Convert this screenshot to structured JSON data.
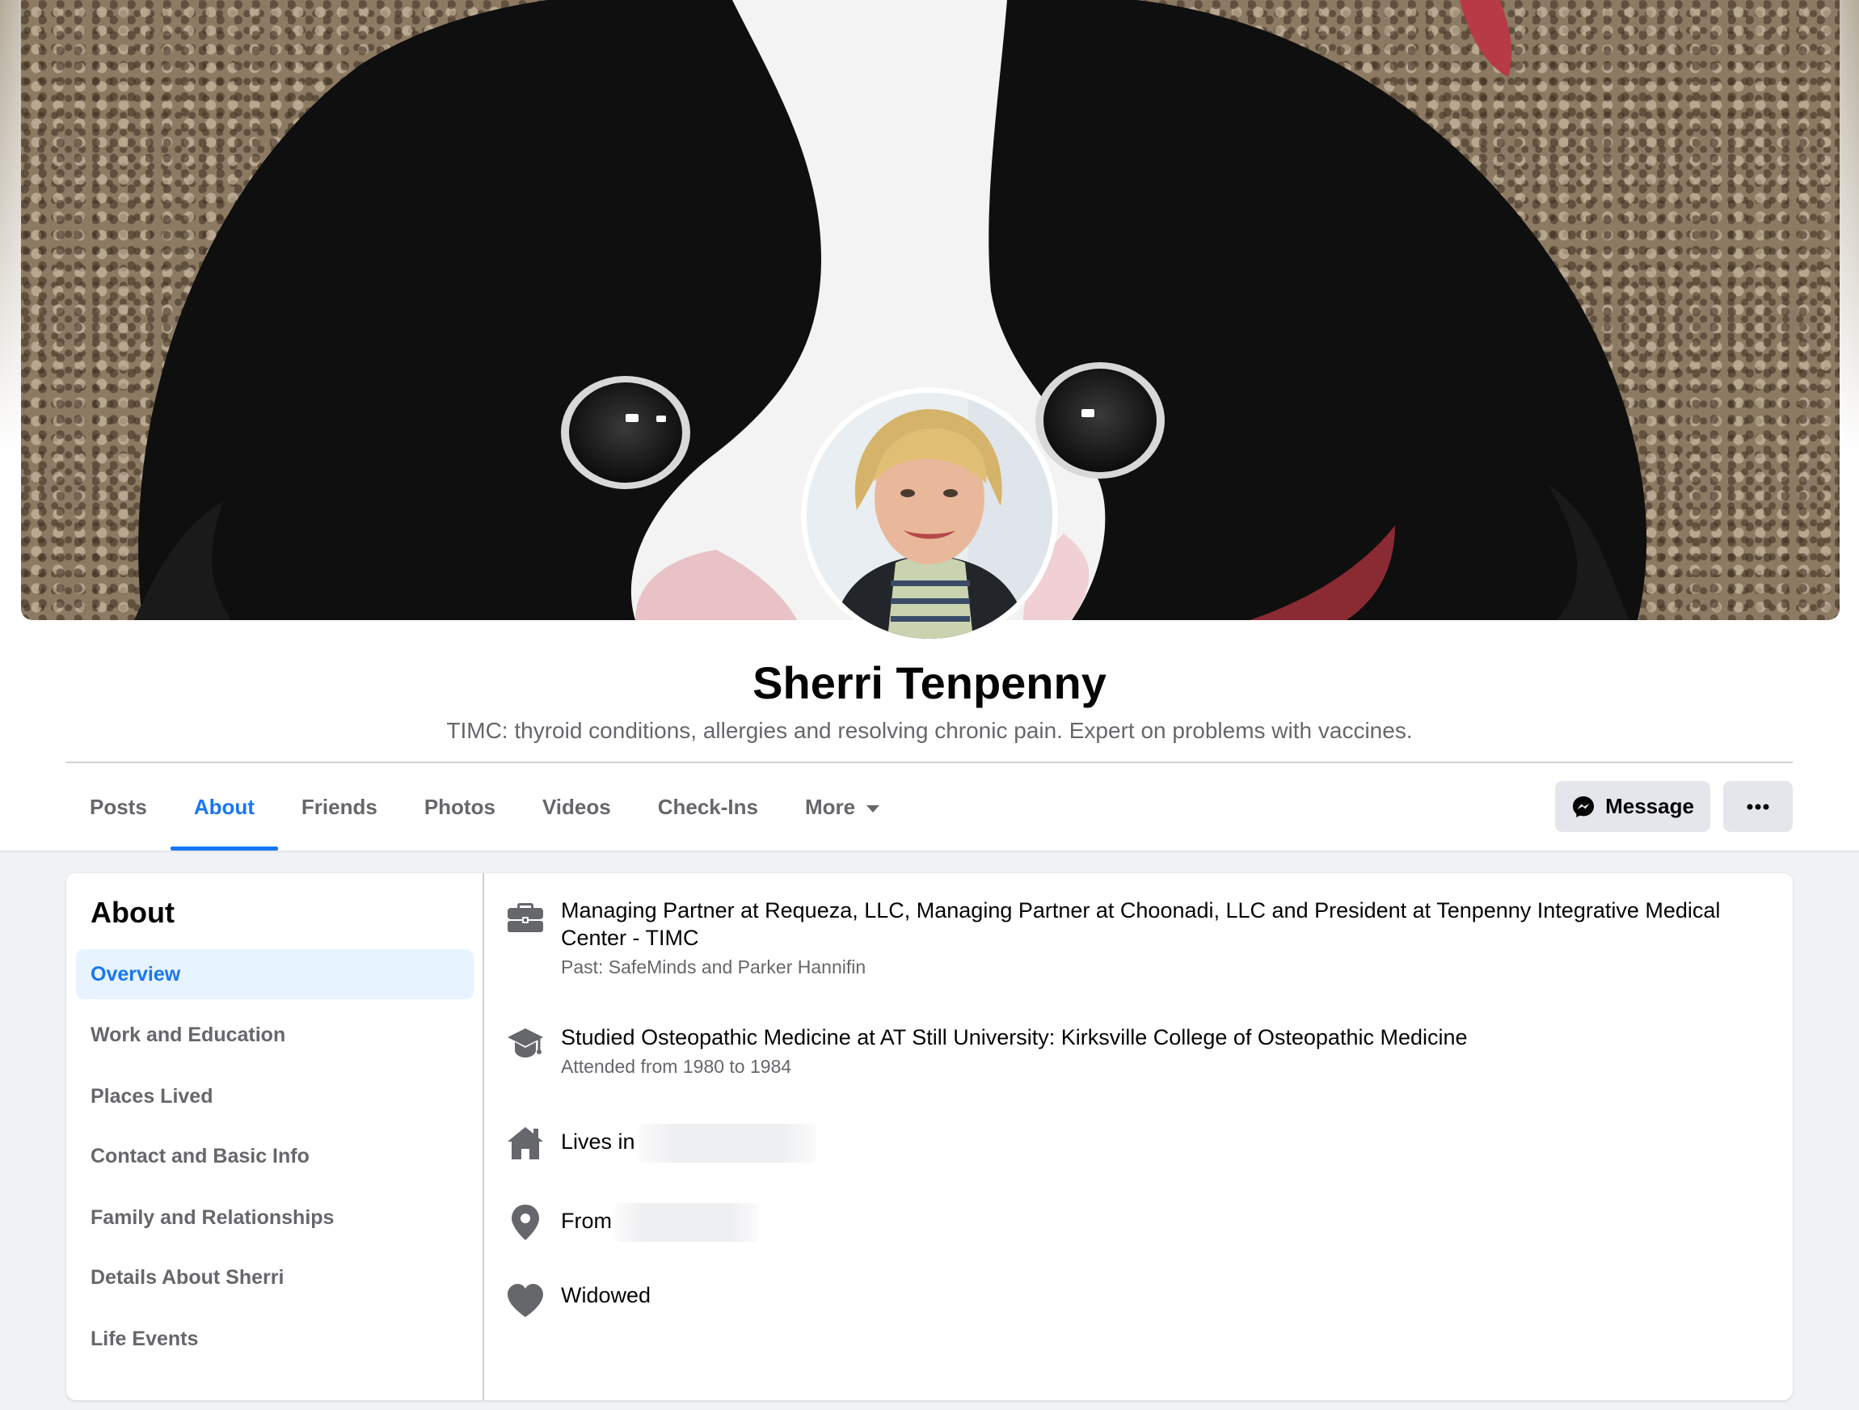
{
  "profile": {
    "name": "Sherri Tenpenny",
    "bio": "TIMC: thyroid conditions, allergies and resolving chronic pain. Expert on problems with vaccines."
  },
  "tabs": [
    {
      "label": "Posts",
      "active": false
    },
    {
      "label": "About",
      "active": true
    },
    {
      "label": "Friends",
      "active": false
    },
    {
      "label": "Photos",
      "active": false
    },
    {
      "label": "Videos",
      "active": false
    },
    {
      "label": "Check-Ins",
      "active": false
    },
    {
      "label": "More",
      "active": false
    }
  ],
  "actions": {
    "message_label": "Message",
    "more_icon": "ellipsis-icon"
  },
  "about": {
    "heading": "About",
    "nav": [
      {
        "label": "Overview",
        "active": true
      },
      {
        "label": "Work and Education"
      },
      {
        "label": "Places Lived"
      },
      {
        "label": "Contact and Basic Info"
      },
      {
        "label": "Family and Relationships"
      },
      {
        "label": "Details About Sherri"
      },
      {
        "label": "Life Events"
      }
    ],
    "overview": {
      "work": {
        "icon": "briefcase-icon",
        "main": "Managing Partner at Requeza, LLC, Managing Partner at Choonadi, LLC and President at Tenpenny Integrative Medical Center - TIMC",
        "sub": "Past: SafeMinds and Parker Hannifin"
      },
      "education": {
        "icon": "graduation-cap-icon",
        "main": "Studied Osteopathic Medicine at AT Still University: Kirksville College of Osteopathic Medicine",
        "sub": "Attended from 1980 to 1984"
      },
      "lives": {
        "icon": "home-icon",
        "label": "Lives in"
      },
      "from": {
        "icon": "location-pin-icon",
        "label": "From"
      },
      "relationship": {
        "icon": "heart-icon",
        "label": "Widowed"
      }
    }
  },
  "colors": {
    "accent": "#1877f2",
    "secondary_text": "#65676b",
    "icon_gray": "#65676b",
    "button_bg": "#e4e6eb",
    "page_bg": "#f0f2f5"
  }
}
